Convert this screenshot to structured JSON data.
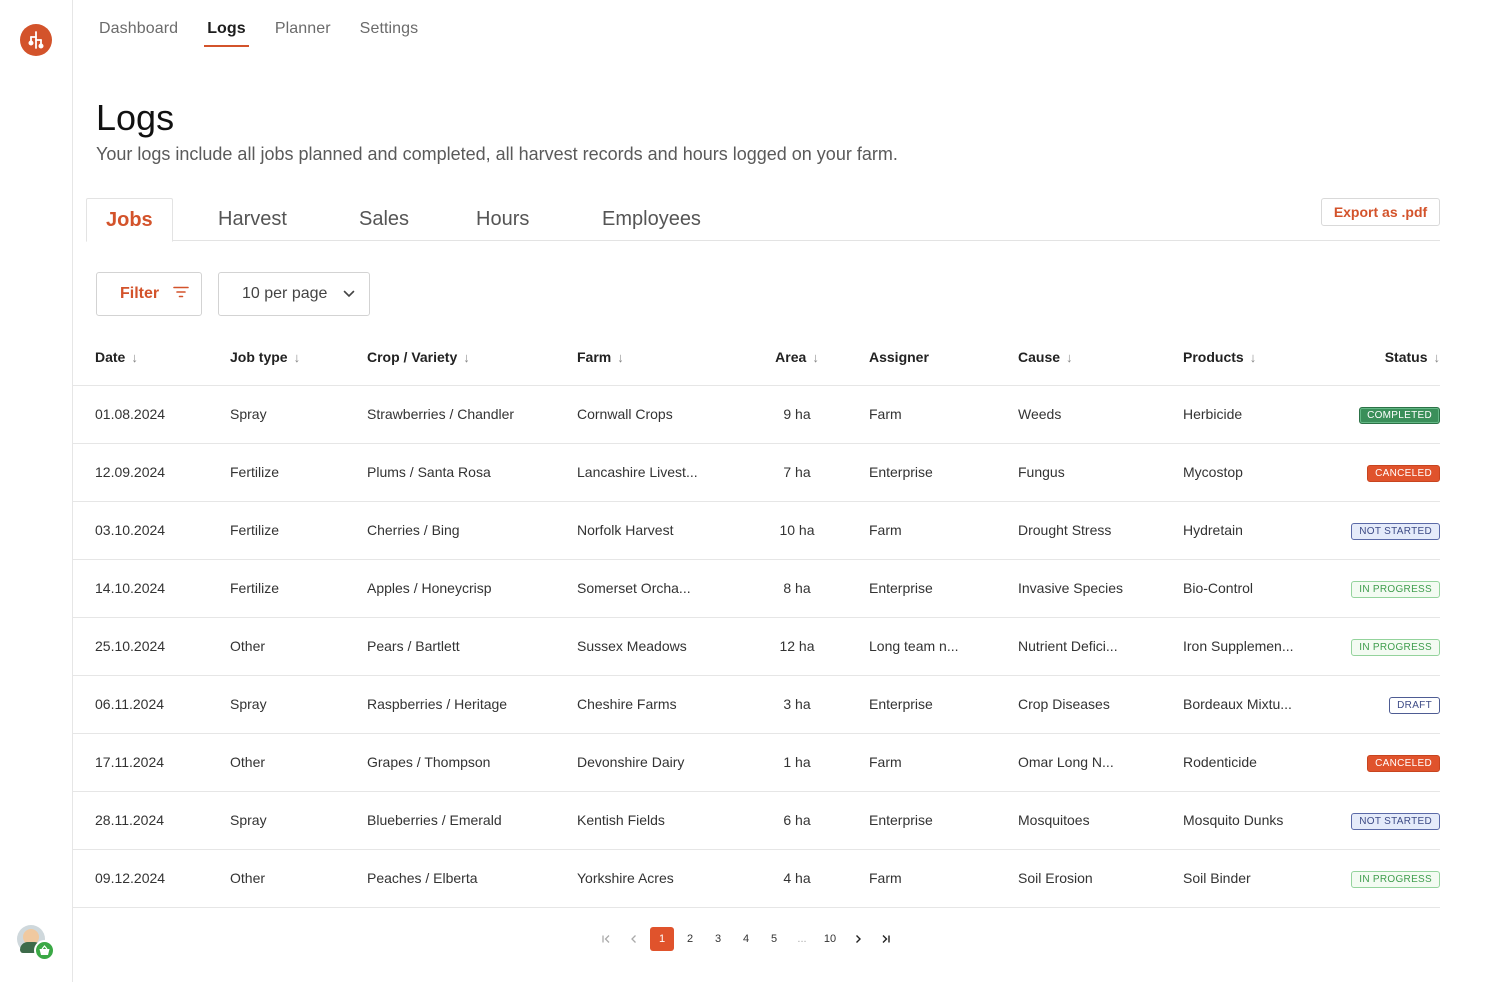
{
  "nav": {
    "items": [
      {
        "label": "Dashboard",
        "active": false
      },
      {
        "label": "Logs",
        "active": true
      },
      {
        "label": "Planner",
        "active": false
      },
      {
        "label": "Settings",
        "active": false
      }
    ]
  },
  "page": {
    "title": "Logs",
    "subtitle": "Your logs include all jobs planned and completed, all harvest records and hours logged on your farm."
  },
  "tabs": [
    {
      "label": "Jobs",
      "active": true
    },
    {
      "label": "Harvest",
      "active": false
    },
    {
      "label": "Sales",
      "active": false
    },
    {
      "label": "Hours",
      "active": false
    },
    {
      "label": "Employees",
      "active": false
    }
  ],
  "actions": {
    "export_label": "Export as .pdf",
    "filter_label": "Filter",
    "per_page_label": "10 per page"
  },
  "table": {
    "columns": [
      "Date",
      "Job type",
      "Crop / Variety",
      "Farm",
      "Area",
      "Assigner",
      "Cause",
      "Products",
      "Status"
    ],
    "rows": [
      {
        "date": "01.08.2024",
        "job": "Spray",
        "crop": "Strawberries / Chandler",
        "farm": "Cornwall Crops",
        "area": "9 ha",
        "assigner": "Farm",
        "cause": "Weeds",
        "products": "Herbicide",
        "status": "COMPLETED"
      },
      {
        "date": "12.09.2024",
        "job": "Fertilize",
        "crop": "Plums / Santa Rosa",
        "farm": "Lancashire Livest...",
        "area": "7 ha",
        "assigner": "Enterprise",
        "cause": "Fungus",
        "products": "Mycostop",
        "status": "CANCELED"
      },
      {
        "date": "03.10.2024",
        "job": "Fertilize",
        "crop": "Cherries / Bing",
        "farm": "Norfolk Harvest",
        "area": "10 ha",
        "assigner": "Farm",
        "cause": "Drought Stress",
        "products": "Hydretain",
        "status": "NOT STARTED"
      },
      {
        "date": "14.10.2024",
        "job": "Fertilize",
        "crop": "Apples / Honeycrisp",
        "farm": "Somerset Orcha...",
        "area": "8 ha",
        "assigner": "Enterprise",
        "cause": "Invasive Species",
        "products": "Bio-Control",
        "status": "IN PROGRESS"
      },
      {
        "date": "25.10.2024",
        "job": "Other",
        "crop": "Pears / Bartlett",
        "farm": "Sussex Meadows",
        "area": "12 ha",
        "assigner": "Long team n...",
        "cause": "Nutrient Defici...",
        "products": "Iron Supplemen...",
        "status": "IN PROGRESS"
      },
      {
        "date": "06.11.2024",
        "job": "Spray",
        "crop": "Raspberries / Heritage",
        "farm": "Cheshire Farms",
        "area": "3 ha",
        "assigner": "Enterprise",
        "cause": "Crop Diseases",
        "products": "Bordeaux Mixtu...",
        "status": "DRAFT"
      },
      {
        "date": "17.11.2024",
        "job": "Other",
        "crop": "Grapes / Thompson",
        "farm": "Devonshire Dairy",
        "area": "1 ha",
        "assigner": "Farm",
        "cause": "Omar Long N...",
        "products": "Rodenticide",
        "status": "CANCELED"
      },
      {
        "date": "28.11.2024",
        "job": "Spray",
        "crop": "Blueberries / Emerald",
        "farm": "Kentish Fields",
        "area": "6 ha",
        "assigner": "Enterprise",
        "cause": "Mosquitoes",
        "products": "Mosquito Dunks",
        "status": "NOT STARTED"
      },
      {
        "date": "09.12.2024",
        "job": "Other",
        "crop": "Peaches / Elberta",
        "farm": "Yorkshire Acres",
        "area": "4 ha",
        "assigner": "Farm",
        "cause": "Soil Erosion",
        "products": "Soil Binder",
        "status": "IN PROGRESS"
      }
    ]
  },
  "pagination": {
    "pages": [
      "1",
      "2",
      "3",
      "4",
      "5",
      "...",
      "10"
    ],
    "current": "1"
  },
  "colors": {
    "accent": "#d3532b",
    "completed": "#3a8f5a",
    "canceled": "#e0532c",
    "not_started": "#e5ebfa",
    "in_progress": "#f3fbf2"
  }
}
